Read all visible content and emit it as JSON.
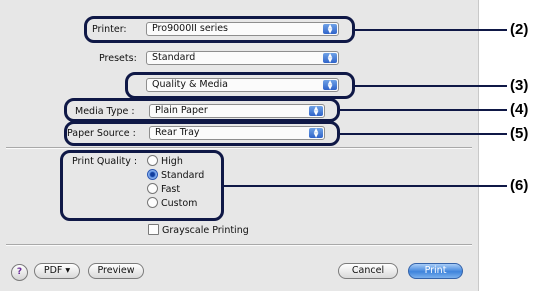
{
  "dialog": {
    "printer_label": "Printer:",
    "printer_value": "Pro9000II series",
    "presets_label": "Presets:",
    "presets_value": "Standard",
    "panel_value": "Quality & Media",
    "media_type_label": "Media Type :",
    "media_type_value": "Plain Paper",
    "paper_source_label": "Paper Source :",
    "paper_source_value": "Rear Tray",
    "print_quality_label": "Print Quality :",
    "quality_options": [
      {
        "label": "High",
        "selected": false
      },
      {
        "label": "Standard",
        "selected": true
      },
      {
        "label": "Fast",
        "selected": false
      },
      {
        "label": "Custom",
        "selected": false
      }
    ],
    "grayscale_label": "Grayscale Printing",
    "help_glyph": "?",
    "pdf_label": "PDF ▾",
    "preview_label": "Preview",
    "cancel_label": "Cancel",
    "print_label": "Print"
  },
  "callouts": {
    "n2": "(2)",
    "n3": "(3)",
    "n4": "(4)",
    "n5": "(5)",
    "n6": "(6)"
  },
  "colors": {
    "callout": "#0f1846",
    "dialog_bg": "#e7e7e7",
    "default_button": "#3f84dc"
  }
}
